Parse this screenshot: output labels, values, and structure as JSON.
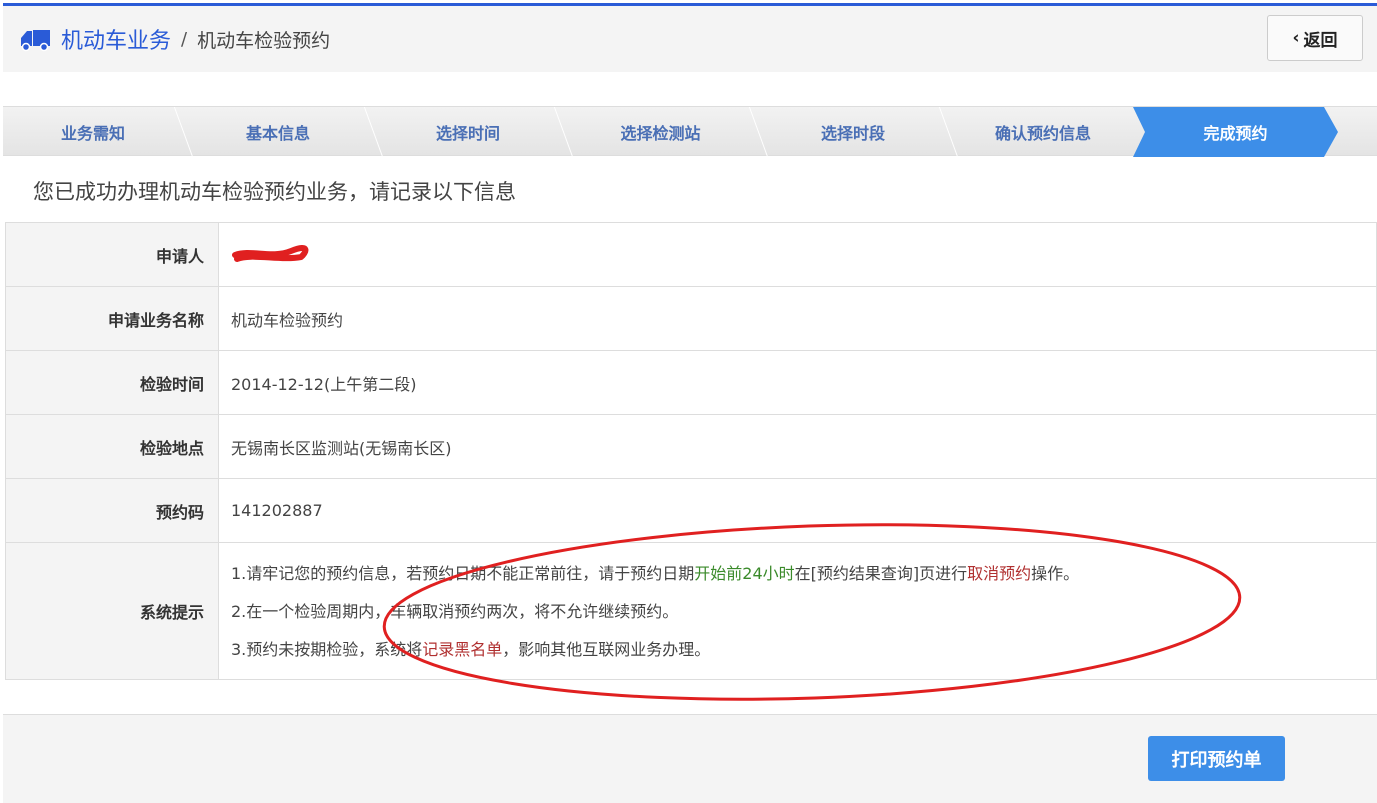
{
  "header": {
    "section": "机动车业务",
    "separator": "/",
    "page": "机动车检验预约",
    "back_label": "返回"
  },
  "steps": [
    {
      "label": "业务需知"
    },
    {
      "label": "基本信息"
    },
    {
      "label": "选择时间"
    },
    {
      "label": "选择检测站"
    },
    {
      "label": "选择时段"
    },
    {
      "label": "确认预约信息"
    },
    {
      "label": "完成预约",
      "active": true
    }
  ],
  "success_message": "您已成功办理机动车检验预约业务，请记录以下信息",
  "details": {
    "applicant_label": "申请人",
    "business_label": "申请业务名称",
    "business_value": "机动车检验预约",
    "time_label": "检验时间",
    "time_value": "2014-12-12(上午第二段)",
    "place_label": "检验地点",
    "place_value": "无锡南长区监测站(无锡南长区)",
    "code_label": "预约码",
    "code_value": "141202887",
    "tips_label": "系统提示",
    "tip1": {
      "a": "1.请牢记您的预约信息，若预约日期不能正常前往，请于预约日期",
      "b": "开始前24小时",
      "c": "在[预约结果查询]页进行",
      "d": "取消预约",
      "e": "操作。"
    },
    "tip2": "2.在一个检验周期内，车辆取消预约两次，将不允许继续预约。",
    "tip3": {
      "a": "3.预约未按期检验，系统将",
      "b": "记录黑名单",
      "c": "，影响其他互联网业务办理。"
    }
  },
  "footer": {
    "print_label": "打印预约单"
  },
  "colors": {
    "accent": "#3d8ee8",
    "link": "#2a5bd7",
    "highlight_green": "#3a8a2a",
    "highlight_red": "#b03030",
    "annotation": "#e02020"
  }
}
